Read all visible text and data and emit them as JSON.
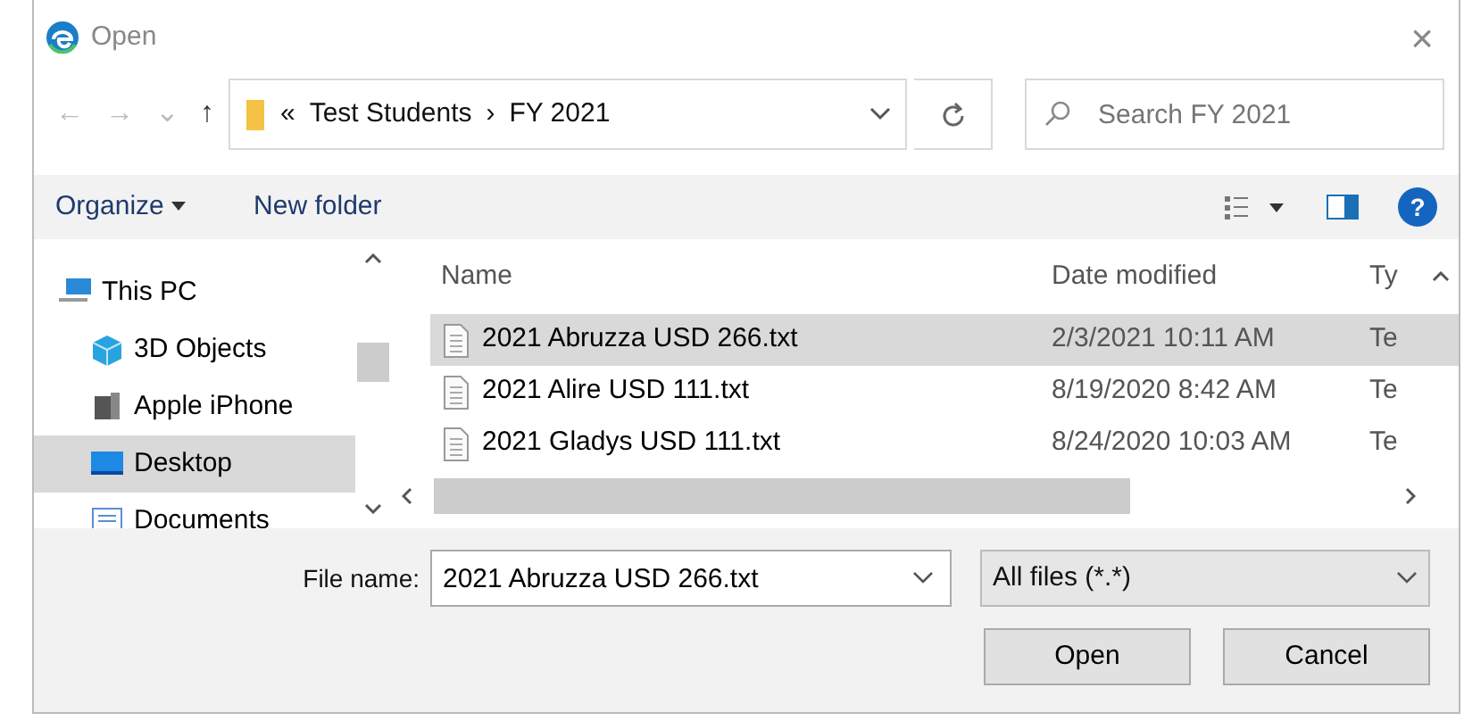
{
  "window": {
    "title": "Open",
    "close": "×"
  },
  "navigation": {
    "back": "←",
    "forward": "→",
    "recent": "⌄",
    "up": "↑"
  },
  "address_bar": {
    "overflow": "«",
    "segments": [
      "Test Students",
      "FY 2021"
    ],
    "separator": "›"
  },
  "search": {
    "placeholder": "Search FY 2021"
  },
  "toolbar": {
    "organize": "Organize",
    "new_folder": "New folder",
    "help": "?"
  },
  "sidebar": {
    "items": [
      {
        "label": "This PC",
        "kind": "pc",
        "selected": false
      },
      {
        "label": "3D Objects",
        "kind": "cube",
        "selected": false
      },
      {
        "label": "Apple iPhone",
        "kind": "phone",
        "selected": false
      },
      {
        "label": "Desktop",
        "kind": "desktop",
        "selected": true
      },
      {
        "label": "Documents",
        "kind": "documents",
        "selected": false
      }
    ]
  },
  "table": {
    "columns": [
      "Name",
      "Date modified",
      "Ty"
    ],
    "rows": [
      {
        "name": "2021 Abruzza USD 266.txt",
        "date": "2/3/2021 10:11 AM",
        "column_3": "Te",
        "selected": true
      },
      {
        "name": "2021 Alire USD 111.txt",
        "date": "8/19/2020 8:42 AM",
        "column_3": "Te",
        "selected": false
      },
      {
        "name": "2021 Gladys USD 111.txt",
        "date": "8/24/2020 10:03 AM",
        "column_3": "Te",
        "selected": false
      }
    ]
  },
  "file_name": {
    "label": "File name:",
    "value": "2021 Abruzza USD 266.txt"
  },
  "file_type": {
    "value": "All files (*.*)"
  },
  "buttons": [
    "Open",
    "Cancel"
  ]
}
